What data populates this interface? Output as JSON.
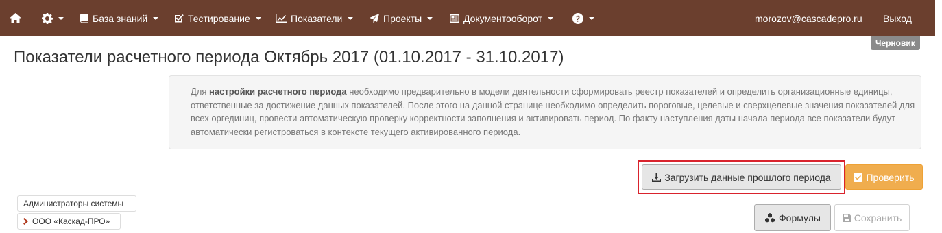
{
  "navbar": {
    "home_icon": "home-icon",
    "settings_icon": "gear-icon",
    "items": [
      {
        "label": "База знаний",
        "icon": "book-icon"
      },
      {
        "label": "Тестирование",
        "icon": "checkbox-icon"
      },
      {
        "label": "Показатели",
        "icon": "line-chart-icon"
      },
      {
        "label": "Проекты",
        "icon": "paper-plane-icon"
      },
      {
        "label": "Документооборот",
        "icon": "newspaper-icon"
      }
    ],
    "help_icon": "question-circle-icon",
    "user": "morozov@cascadepro.ru",
    "logout": "Выход"
  },
  "status_badge": "Черновик",
  "page_title": "Показатели расчетного периода Октябрь 2017 (01.10.2017 - 31.10.2017)",
  "info": {
    "prefix": "Для ",
    "bold": "настройки расчетного периода",
    "text": " необходимо предварительно в модели деятельности сформировать реестр показателей и определить организационные единицы, ответственные за достижение данных показателей. После этого на данной странице необходимо определить пороговые, целевые и сверхцелевые значения показателей для всех оргединиц, провести автоматическую проверку корректности заполнения и активировать период. По факту наступления даты начала периода все показатели будут автоматически регистроваться в контексте текущего активированного периода."
  },
  "buttons": {
    "load_previous": "Загрузить данные прошлого периода",
    "check": "Проверить",
    "formulas": "Формулы",
    "save": "Сохранить"
  },
  "org_tree": {
    "admins": "Администраторы системы",
    "company": "ООО «Каскад-ПРО»"
  },
  "colors": {
    "navbar": "#6b3f2e",
    "warning": "#f0ad4e",
    "highlight": "#d9232d",
    "badge": "#8a8a8a",
    "chevron": "#b03a1e"
  }
}
